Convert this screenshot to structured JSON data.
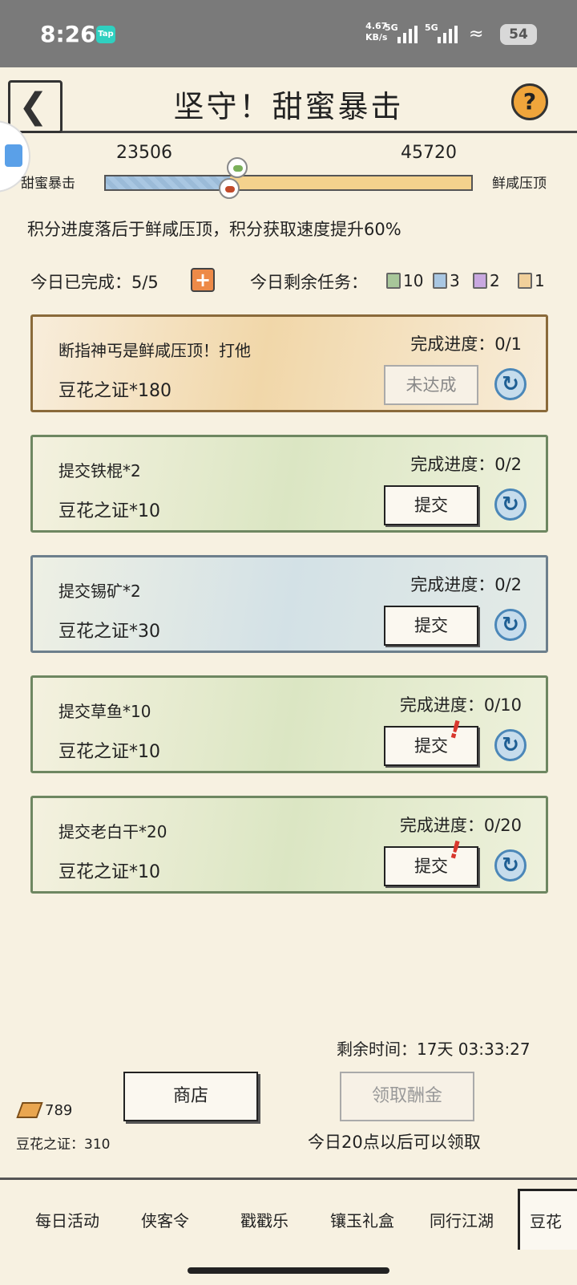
{
  "status": {
    "time": "8:26",
    "app_badge": "Tap",
    "net_speed_value": "4.67",
    "net_speed_unit": "KB/s",
    "signal1": "5G",
    "signal2": "5G",
    "battery": "54"
  },
  "header": {
    "title": "坚守！甜蜜暴击",
    "back_icon": "back-arrow-icon",
    "help_label": "?"
  },
  "score": {
    "left_team": "甜蜜暴击",
    "right_team": "鲜咸压顶",
    "left_score": "23506",
    "right_score": "45720",
    "left_fraction": 0.34,
    "left_color": "#a9c7e2",
    "right_color": "#f4d28d"
  },
  "bonus_text": "积分进度落后于鲜咸压顶，积分获取速度提升60%",
  "today": {
    "completed": "今日已完成：5/5",
    "plus_label": "+",
    "remaining_label": "今日剩余任务：",
    "remaining": [
      {
        "count": "10",
        "color": "#a8c79a"
      },
      {
        "count": "3",
        "color": "#a9c7e2"
      },
      {
        "count": "2",
        "color": "#c9a8e0"
      },
      {
        "count": "1",
        "color": "#f1d09b"
      }
    ]
  },
  "tasks": [
    {
      "name": "断指神丐是鲜咸压顶！打他",
      "progress": "完成进度：0/1",
      "reward": "豆花之证*180",
      "button": "未达成",
      "refresh": "↻"
    },
    {
      "name": "提交铁棍*2",
      "progress": "完成进度：0/2",
      "reward": "豆花之证*10",
      "button": "提交",
      "refresh": "↻"
    },
    {
      "name": "提交锡矿*2",
      "progress": "完成进度：0/2",
      "reward": "豆花之证*30",
      "button": "提交",
      "refresh": "↻"
    },
    {
      "name": "提交草鱼*10",
      "progress": "完成进度：0/10",
      "reward": "豆花之证*10",
      "button": "提交",
      "refresh": "↻",
      "alert": "!"
    },
    {
      "name": "提交老白干*20",
      "progress": "完成进度：0/20",
      "reward": "豆花之证*10",
      "button": "提交",
      "refresh": "↻",
      "alert": "!"
    }
  ],
  "bottom": {
    "remaining_time": "剩余时间：17天 03:33:27",
    "shop_button": "商店",
    "claim_button": "领取酬金",
    "claim_note": "今日20点以后可以领取",
    "gold_count": "789",
    "bean_count": "豆花之证：310"
  },
  "tabs": [
    "每日活动",
    "侠客令",
    "戳戳乐",
    "镶玉礼盒",
    "同行江湖",
    "豆花"
  ]
}
